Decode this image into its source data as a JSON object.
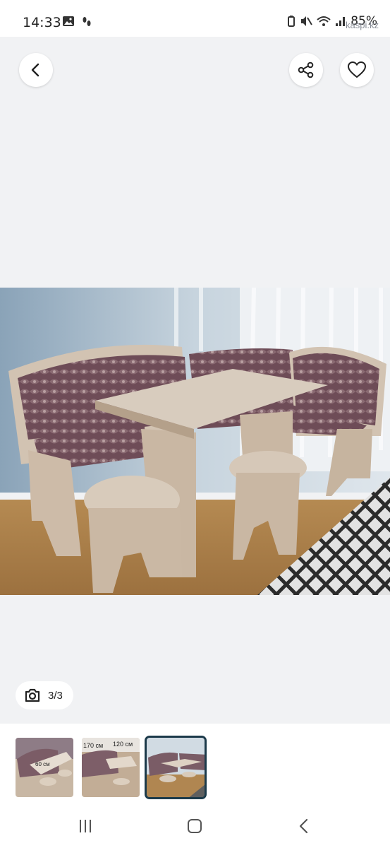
{
  "status": {
    "time": "14:33",
    "battery": "85%",
    "watermark": "kaspi.kz"
  },
  "icons": {
    "back": "chevron-left-icon",
    "share": "share-icon",
    "favorite": "heart-icon",
    "camera": "camera-icon"
  },
  "viewer": {
    "counter": "3/3",
    "photo_description_alt": "Kitchen corner set with table and stools"
  },
  "thumbnails": [
    {
      "label_a": "60 см",
      "label_b": "",
      "selected": false
    },
    {
      "label_a": "170 см",
      "label_b": "120 см",
      "selected": false
    },
    {
      "label_a": "",
      "label_b": "",
      "selected": true
    }
  ],
  "colors": {
    "background": "#f1f2f4",
    "selected_outline": "#1c3a4a"
  }
}
